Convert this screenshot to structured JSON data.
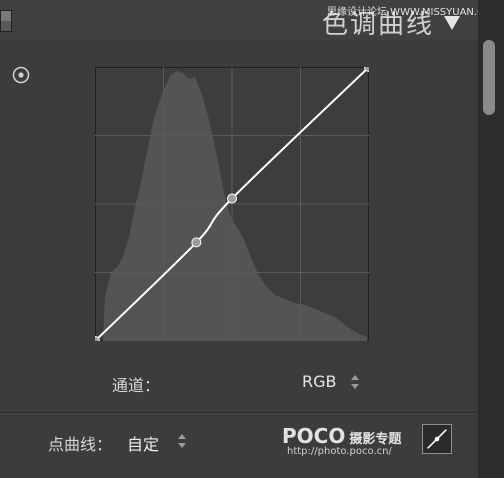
{
  "panel": {
    "title": "色调曲线",
    "watermark": "思缘设计论坛 WWW.MISSYUAN.COM"
  },
  "icons": {
    "collapse": "triangle-down-icon",
    "target": "target-adjustment-icon",
    "edit_curve": "point-curve-edit-icon",
    "spinner": "up-down-spinner-icon"
  },
  "curve": {
    "points": [
      [
        0,
        0
      ],
      [
        0.37,
        0.36
      ],
      [
        0.5,
        0.52
      ],
      [
        1,
        1
      ]
    ]
  },
  "channel": {
    "label": "通道：",
    "value": "RGB"
  },
  "point_curve": {
    "label": "点曲线：",
    "value": "自定"
  },
  "watermark_logo": {
    "brand": "POCO",
    "subtitle": "摄影专题",
    "url": "http://photo.poco.cn/"
  },
  "colors": {
    "background": "#3c3c3c",
    "graph_bg": "#3d3d3d",
    "histogram": "#545454",
    "curve": "#ffffff"
  }
}
